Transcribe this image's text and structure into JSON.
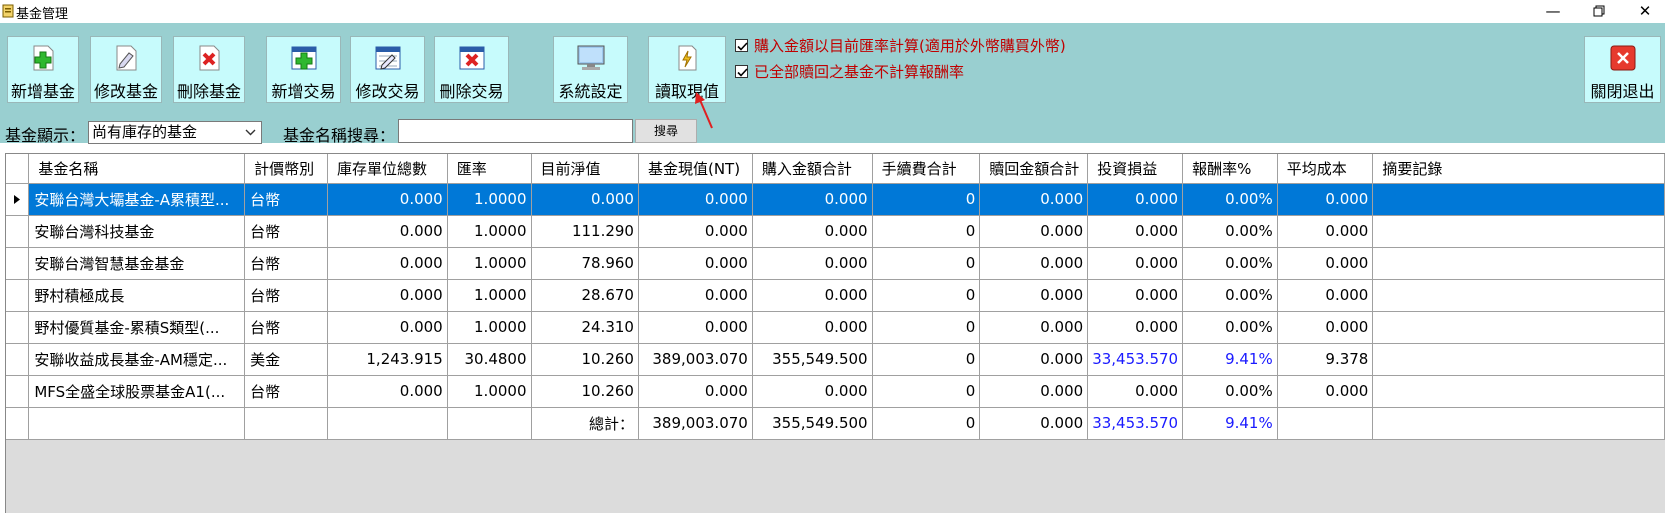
{
  "window": {
    "title": "基金管理",
    "minimize": "—",
    "close": "✕"
  },
  "toolbar": {
    "buttons": [
      {
        "label": "新增基金",
        "icon": "add-icon"
      },
      {
        "label": "修改基金",
        "icon": "edit-icon"
      },
      {
        "label": "刪除基金",
        "icon": "delete-icon"
      },
      {
        "label": "新增交易",
        "icon": "add-transaction-icon"
      },
      {
        "label": "修改交易",
        "icon": "edit-transaction-icon"
      },
      {
        "label": "刪除交易",
        "icon": "delete-transaction-icon"
      },
      {
        "label": "系統設定",
        "icon": "monitor-icon"
      },
      {
        "label": "讀取現值",
        "icon": "lightning-document-icon"
      }
    ],
    "exit_label": "關閉退出",
    "options": [
      {
        "label": "購入金額以目前匯率計算(適用於外幣購買外幣)",
        "checked": true
      },
      {
        "label": "已全部贖回之基金不計算報酬率",
        "checked": true
      }
    ]
  },
  "filter": {
    "display_label": "基金顯示：",
    "display_value": "尚有庫存的基金",
    "search_label": "基金名稱搜尋：",
    "search_value": "",
    "search_button": "搜尋"
  },
  "grid": {
    "columns": [
      "基金名稱",
      "計價幣別",
      "庫存單位總數",
      "匯率",
      "目前淨值",
      "基金現值(NT)",
      "購入金額合計",
      "手續費合計",
      "贖回金額合計",
      "投資損益",
      "報酬率%",
      "平均成本",
      "摘要記錄"
    ],
    "rows": [
      [
        "安聯台灣大壩基金-A累積型...",
        "台幣",
        "0.000",
        "1.0000",
        "0.000",
        "0.000",
        "0.000",
        "0",
        "0.000",
        "0.000",
        "0.00%",
        "0.000",
        ""
      ],
      [
        "安聯台灣科技基金",
        "台幣",
        "0.000",
        "1.0000",
        "111.290",
        "0.000",
        "0.000",
        "0",
        "0.000",
        "0.000",
        "0.00%",
        "0.000",
        ""
      ],
      [
        "安聯台灣智慧基金基金",
        "台幣",
        "0.000",
        "1.0000",
        "78.960",
        "0.000",
        "0.000",
        "0",
        "0.000",
        "0.000",
        "0.00%",
        "0.000",
        ""
      ],
      [
        "野村積極成長",
        "台幣",
        "0.000",
        "1.0000",
        "28.670",
        "0.000",
        "0.000",
        "0",
        "0.000",
        "0.000",
        "0.00%",
        "0.000",
        ""
      ],
      [
        "野村優質基金-累積S類型(...",
        "台幣",
        "0.000",
        "1.0000",
        "24.310",
        "0.000",
        "0.000",
        "0",
        "0.000",
        "0.000",
        "0.00%",
        "0.000",
        ""
      ],
      [
        "安聯收益成長基金-AM穩定...",
        "美金",
        "1,243.915",
        "30.4800",
        "10.260",
        "389,003.070",
        "355,549.500",
        "0",
        "0.000",
        "33,453.570",
        "9.41%",
        "9.378",
        ""
      ],
      [
        "MFS全盛全球股票基金A1(...",
        "台幣",
        "0.000",
        "1.0000",
        "10.260",
        "0.000",
        "0.000",
        "0",
        "0.000",
        "0.000",
        "0.00%",
        "0.000",
        ""
      ]
    ],
    "totals": [
      "",
      "",
      "",
      "",
      "總計：",
      "389,003.070",
      "355,549.500",
      "0",
      "0.000",
      "33,453.570",
      "9.41%",
      "",
      ""
    ],
    "selected_row": 0,
    "highlight_color": "#1a1aff"
  }
}
